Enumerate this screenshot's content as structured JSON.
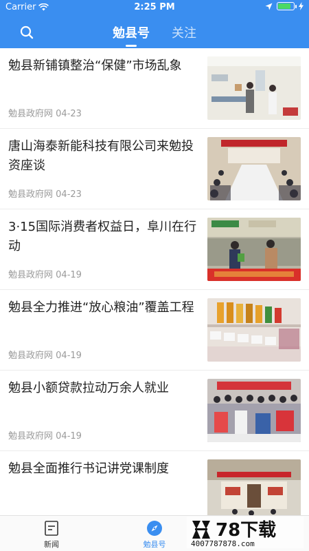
{
  "status_bar": {
    "carrier": "Carrier",
    "time": "2:25 PM"
  },
  "nav": {
    "tabs": [
      {
        "label": "勉县号",
        "active": true
      },
      {
        "label": "关注",
        "active": false
      }
    ]
  },
  "articles": [
    {
      "title": "勉县新铺镇整治“保健”市场乱象",
      "source": "勉县政府网",
      "date": "04-23"
    },
    {
      "title": "唐山海泰新能科技有限公司来勉投资座谈",
      "source": "勉县政府网",
      "date": "04-23"
    },
    {
      "title": "3·15国际消费者权益日，阜川在行动",
      "source": "勉县政府网",
      "date": "04-19"
    },
    {
      "title": "勉县全力推进“放心粮油”覆盖工程",
      "source": "勉县政府网",
      "date": "04-19"
    },
    {
      "title": "勉县小额贷款拉动万余人就业",
      "source": "勉县政府网",
      "date": "04-19"
    },
    {
      "title": "勉县全面推行书记讲党课制度",
      "source": "",
      "date": ""
    }
  ],
  "bottom_tabs": [
    {
      "label": "新闻",
      "icon": "document-icon",
      "active": false
    },
    {
      "label": "勉县号",
      "icon": "compass-icon",
      "active": true
    }
  ],
  "watermark": {
    "brand": "78下载",
    "url": "4007787878.com"
  },
  "colors": {
    "primary": "#3a8ef0",
    "battery": "#4cd964"
  }
}
